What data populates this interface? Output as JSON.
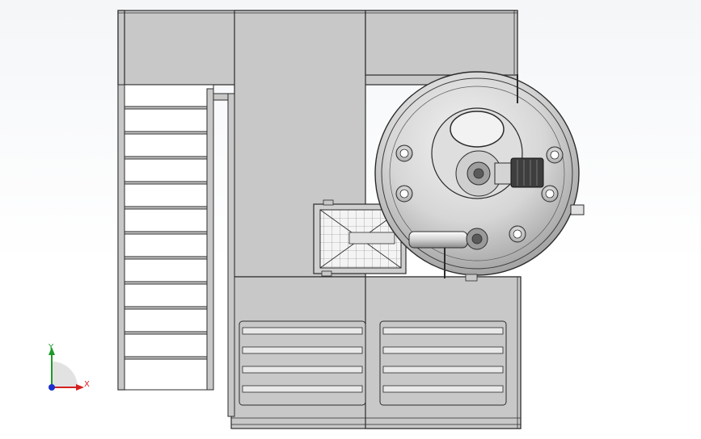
{
  "triad": {
    "x_label": "X",
    "y_label": "Y"
  },
  "colors": {
    "frame": "#c8c8c8",
    "frame_stroke": "#2b2b2b",
    "vessel": "#d9d9d9",
    "triad_x": "#d42020",
    "triad_y": "#1e9a2a",
    "triad_z": "#1a2fd0"
  }
}
